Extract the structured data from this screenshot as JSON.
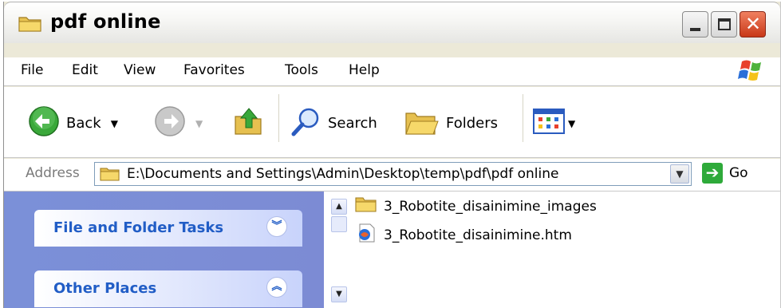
{
  "window": {
    "title": "pdf online"
  },
  "menu": {
    "items": [
      "File",
      "Edit",
      "View",
      "Favorites",
      "Tools",
      "Help"
    ]
  },
  "toolbar": {
    "back_label": "Back",
    "search_label": "Search",
    "folders_label": "Folders"
  },
  "address": {
    "label": "Address",
    "value": "E:\\Documents and Settings\\Admin\\Desktop\\temp\\pdf\\pdf online",
    "go_label": "Go"
  },
  "taskpane": {
    "panels": [
      {
        "title": "File and Folder Tasks",
        "state": "collapsed"
      },
      {
        "title": "Other Places",
        "state": "expanded"
      }
    ]
  },
  "files": [
    {
      "name": "3_Robotite_disainimine_images",
      "type": "folder-icon"
    },
    {
      "name": "3_Robotite_disainimine.htm",
      "type": "html-document-icon"
    }
  ],
  "colors": {
    "taskpane_bg": "#7c8bd4",
    "taskpane_title": "#215dc6",
    "go_green": "#2eaa3a",
    "close_red": "#d84a28"
  }
}
